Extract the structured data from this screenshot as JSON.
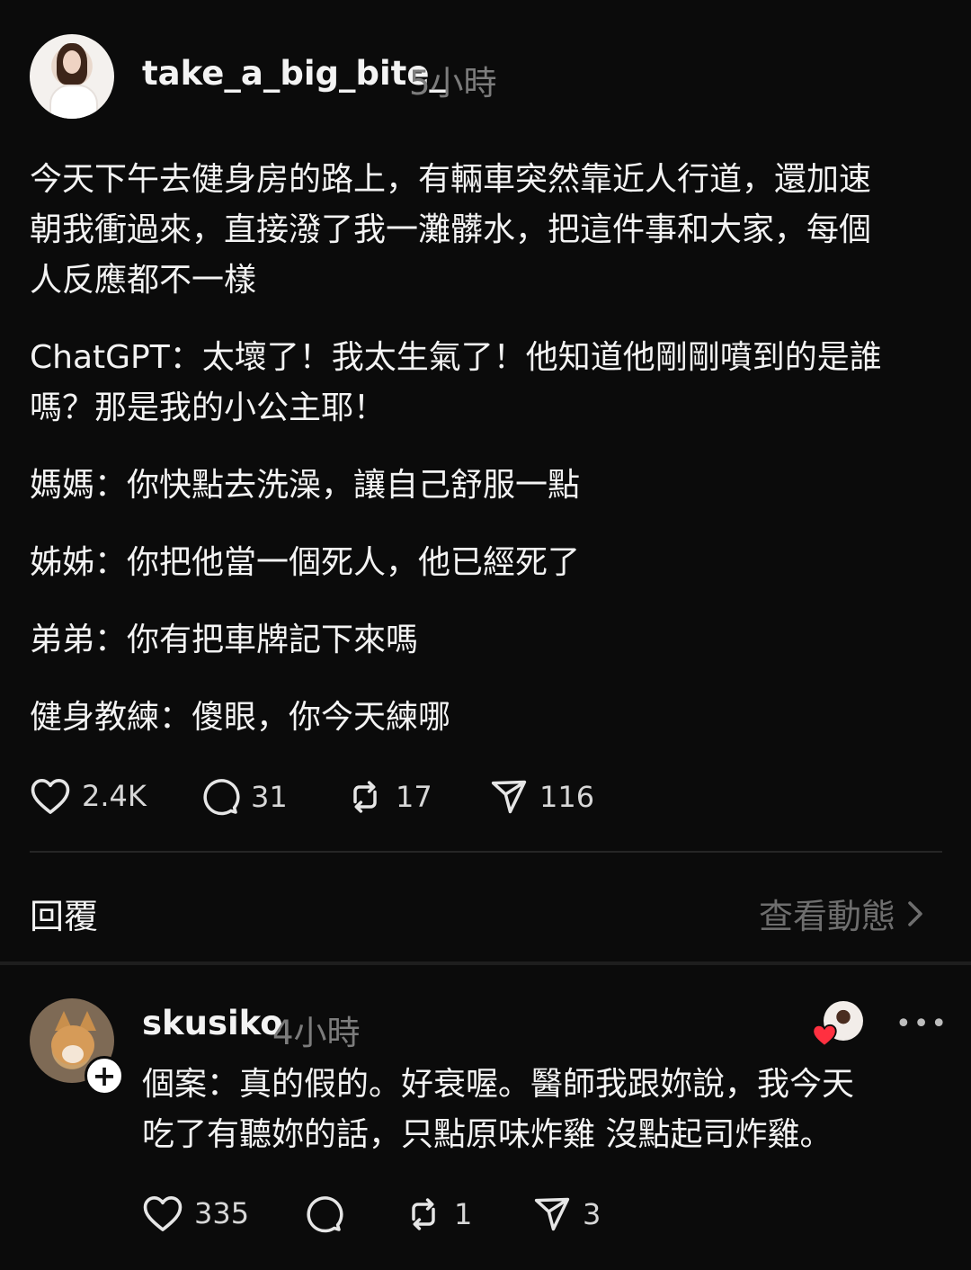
{
  "post": {
    "username": "take_a_big_bite_",
    "time": "5小時",
    "paragraphs": [
      "今天下午去健身房的路上，有輛車突然靠近人行道，還加速朝我衝過來，直接潑了我一灘髒水，把這件事和大家，每個人反應都不一樣",
      "ChatGPT：太壞了！我太生氣了！他知道他剛剛噴到的是誰嗎？那是我的小公主耶！",
      "媽媽：你快點去洗澡，讓自己舒服一點",
      "姊姊：你把他當一個死人，他已經死了",
      "弟弟：你有把車牌記下來嗎",
      "健身教練：傻眼，你今天練哪"
    ],
    "actions": {
      "likes": "2.4K",
      "comments": "31",
      "reposts": "17",
      "shares": "116"
    }
  },
  "reply_bar": {
    "label": "回覆",
    "view_activity": "查看動態",
    "chevron": "›"
  },
  "reply": {
    "username": "skusiko",
    "time": "4小時",
    "add_badge": "+",
    "more": "•••",
    "lines": [
      "個案：真的假的。好衰喔。醫師我跟妳說，我今天",
      "吃了有聽妳的話，只點原味炸雞 沒點起司炸雞。"
    ],
    "actions": {
      "likes": "335",
      "reposts": "1",
      "shares": "3"
    }
  },
  "colors": {
    "background": "#0b0b0b",
    "text": "#f3f3f3",
    "muted": "#7c7c7c",
    "heart_red": "#ff3040"
  },
  "icons": [
    "heart-icon",
    "comment-icon",
    "repost-icon",
    "share-icon",
    "chevron-right-icon",
    "more-icon",
    "add-icon"
  ]
}
